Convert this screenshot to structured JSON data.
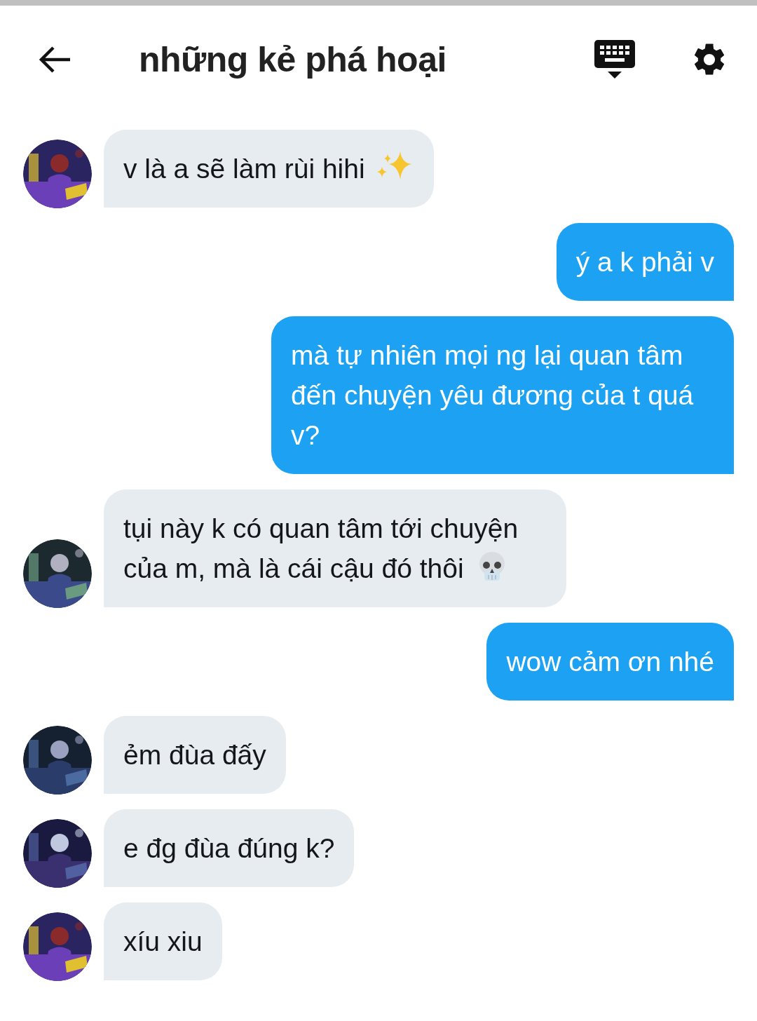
{
  "header": {
    "title": "những kẻ phá hoại"
  },
  "messages": [
    {
      "kind": "received",
      "text": "v là a sẽ làm rùi hihi",
      "emoji": {
        "kind": "sparkles"
      }
    },
    {
      "kind": "sent",
      "text": "ý a k phải v"
    },
    {
      "kind": "sent",
      "text": "mà tự nhiên mọi ng lại quan tâm đến chuyện yêu đương của t quá v?"
    },
    {
      "kind": "received",
      "text": "tụi này k có quan tâm tới chuyện của m, mà là cái cậu đó thôi",
      "emoji": {
        "kind": "skull"
      }
    },
    {
      "kind": "sent",
      "text": "wow cảm ơn nhé"
    },
    {
      "kind": "received",
      "text": "ẻm đùa đấy"
    },
    {
      "kind": "received",
      "text": "e đg đùa đúng k?"
    },
    {
      "kind": "received",
      "text": "xíu xiu"
    }
  ]
}
